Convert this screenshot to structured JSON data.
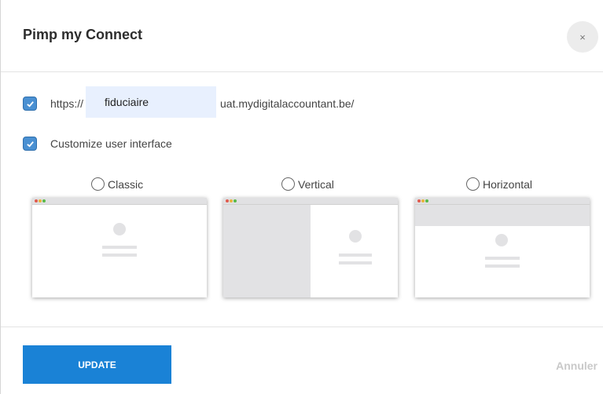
{
  "dialog": {
    "title": "Pimp my Connect",
    "close_label": "×"
  },
  "url": {
    "checked": true,
    "prefix": "https://",
    "subdomain_value": "fiduciaire",
    "suffix": "uat.mydigitalaccountant.be/"
  },
  "customize": {
    "checked": true,
    "label": "Customize user interface"
  },
  "layouts": [
    {
      "label": "Classic",
      "selected": false
    },
    {
      "label": "Vertical",
      "selected": false
    },
    {
      "label": "Horizontal",
      "selected": false
    }
  ],
  "footer": {
    "update_label": "UPDATE",
    "cancel_label": "Annuler"
  },
  "colors": {
    "accent": "#1a82d6",
    "checkbox": "#4a90d2",
    "input_bg": "#e8f0fe",
    "placeholder_gray": "#e2e2e4",
    "dot_red": "#e05a4e",
    "dot_yellow": "#e9b43a",
    "dot_green": "#58b948"
  }
}
